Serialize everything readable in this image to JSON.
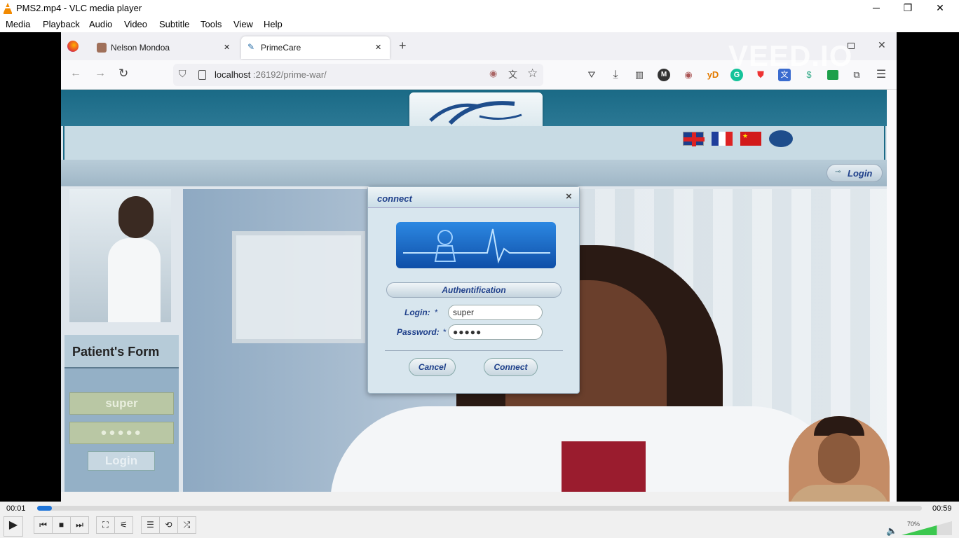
{
  "window": {
    "title": "PMS2.mp4 - VLC media player",
    "controls": {
      "minimize": "─",
      "maximize": "❐",
      "close": "✕"
    }
  },
  "menu": [
    "Media",
    "Playback",
    "Audio",
    "Video",
    "Subtitle",
    "Tools",
    "View",
    "Help"
  ],
  "browser": {
    "tabs": [
      {
        "label": "Nelson Mondoa",
        "close": "✕"
      },
      {
        "label": "PrimeCare",
        "close": "✕"
      }
    ],
    "new_tab": "+",
    "url_host": "localhost",
    "url_rest": ":26192/prime-war/",
    "ext_labels": {
      "m": "M",
      "yd": "yD"
    }
  },
  "watermark": "VEED.IO",
  "site": {
    "header_login": "Login",
    "patients_form_title": "Patient's Form",
    "side_login_value": "super",
    "side_password_value": "●●●●●",
    "side_login_button": "Login"
  },
  "dialog": {
    "title": "connect",
    "close": "×",
    "section": "Authentification",
    "login_label": "Login:",
    "password_label": "Password:",
    "required": "*",
    "login_value": "super",
    "password_value": "●●●●●",
    "cancel": "Cancel",
    "connect": "Connect"
  },
  "player": {
    "elapsed": "00:01",
    "total": "00:59",
    "progress": 0.017,
    "volume": "70%",
    "volume_level": 0.7
  }
}
